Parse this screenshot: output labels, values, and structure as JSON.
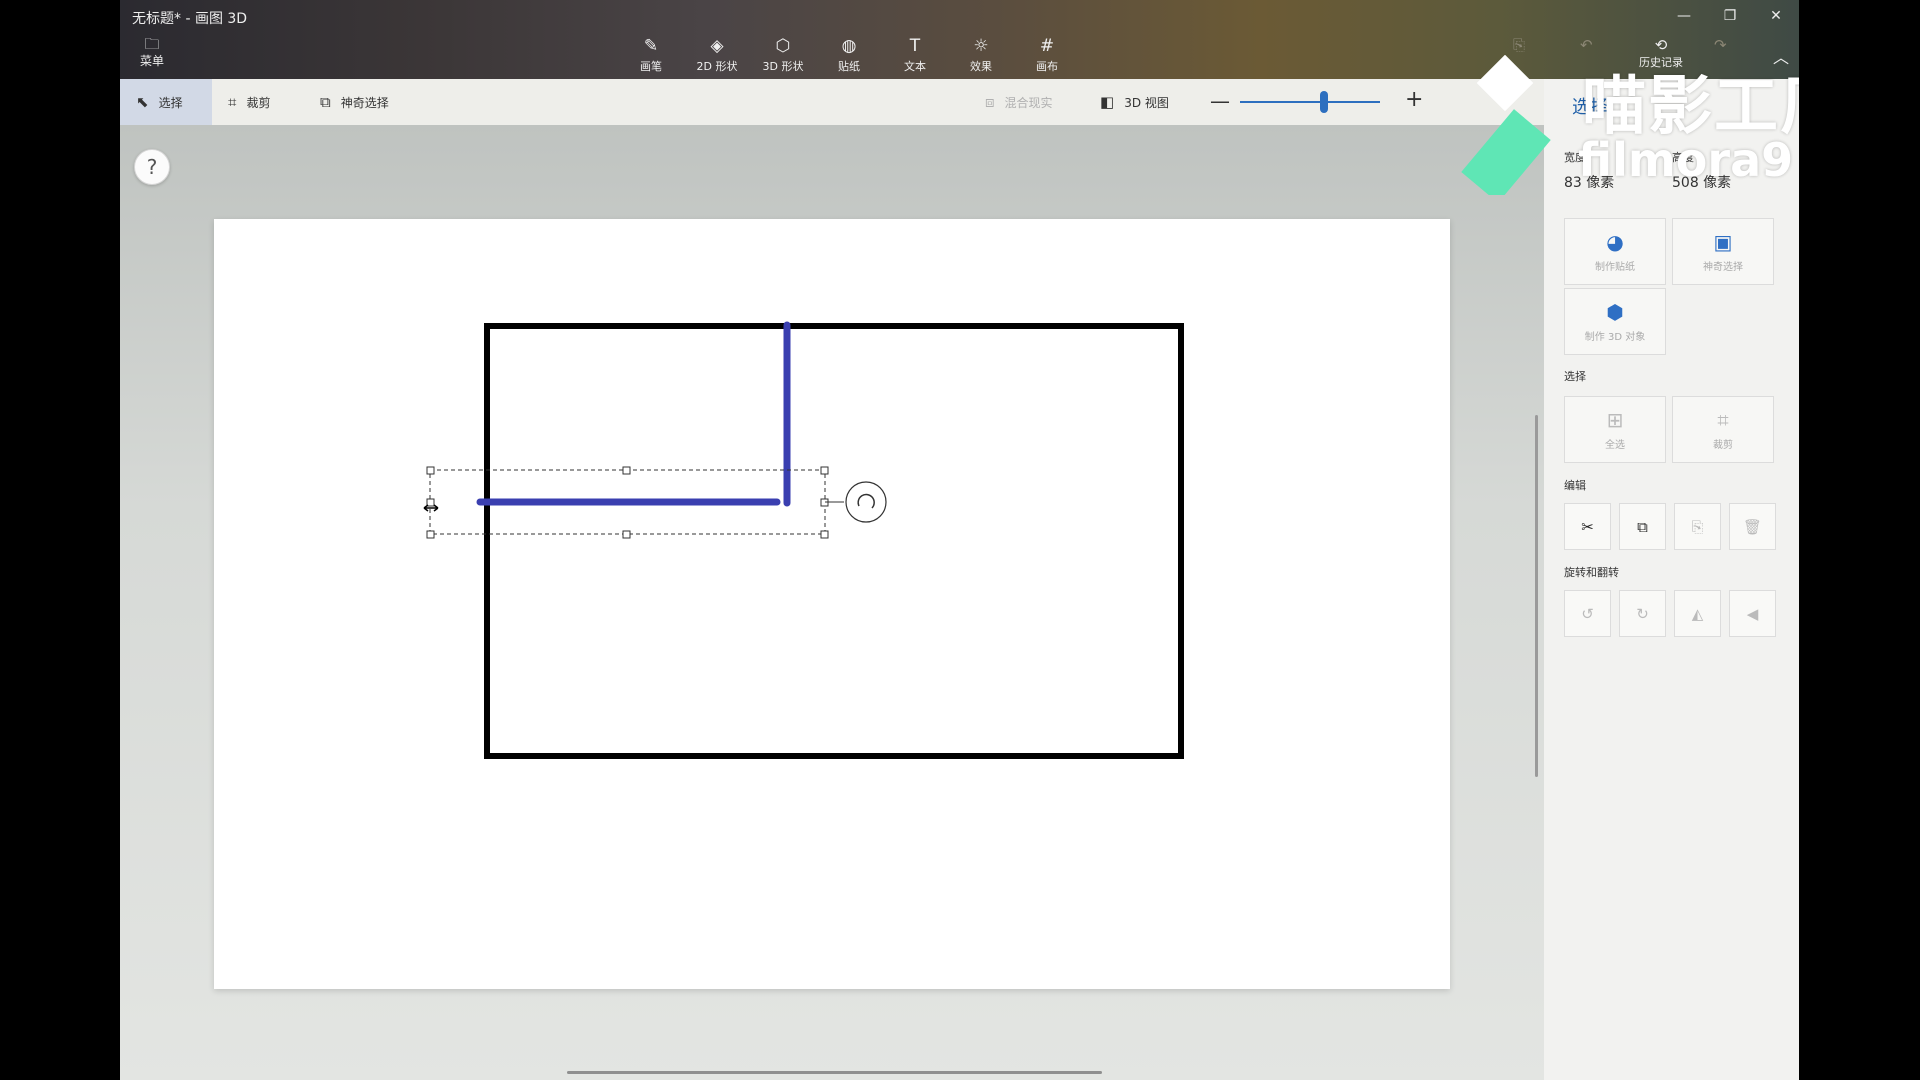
{
  "window": {
    "title": "无标题* - 画图 3D"
  },
  "menu": {
    "label": "菜单"
  },
  "tools": [
    {
      "id": "brushes",
      "icon": "brush-icon",
      "label": "画笔"
    },
    {
      "id": "shapes2d",
      "icon": "2d-shape-icon",
      "label": "2D 形状"
    },
    {
      "id": "shapes3d",
      "icon": "3d-shape-icon",
      "label": "3D 形状"
    },
    {
      "id": "stickers",
      "icon": "sticker-icon",
      "label": "贴纸"
    },
    {
      "id": "text",
      "icon": "text-icon",
      "label": "文本"
    },
    {
      "id": "effects",
      "icon": "effects-icon",
      "label": "效果"
    },
    {
      "id": "canvas",
      "icon": "canvas-icon",
      "label": "画布"
    }
  ],
  "history": {
    "label": "历史记录"
  },
  "toolbar2": {
    "select_label": "选择",
    "crop_label": "裁剪",
    "magic_select_label": "神奇选择",
    "mixed_reality_label": "混合现实",
    "view3d_label": "3D 视图"
  },
  "zoom": {
    "level": 0.6
  },
  "panel": {
    "title": "选择",
    "width_label": "宽度",
    "width_value": "83 像素",
    "height_label": "高度",
    "height_value": "508 像素",
    "make_sticker": "制作贴纸",
    "magic_select": "神奇选择",
    "make_3d": "制作 3D 对象",
    "select_section": "选择",
    "select_all": "全选",
    "crop": "裁剪",
    "edit_section": "编辑",
    "rotate_section": "旋转和翻转"
  },
  "help": {
    "label": "?"
  },
  "watermark": {
    "line1": "喵影工厂",
    "line2": "filmora9"
  },
  "colors": {
    "accent": "#2d6fbf",
    "stroke_blue": "#3a3fb0",
    "frame": "#000000"
  }
}
